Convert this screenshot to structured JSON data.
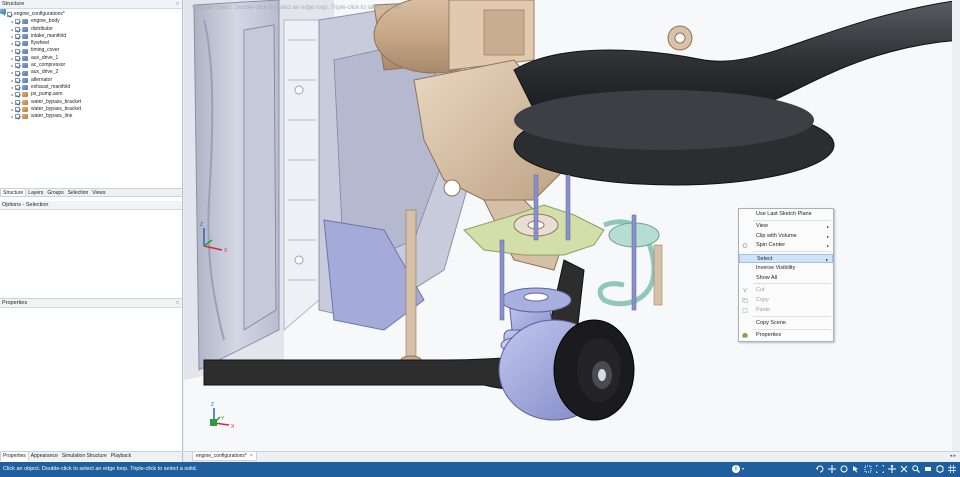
{
  "panels": {
    "structure_title": "Structure",
    "options_title": "Options - Selection",
    "properties_title": "Properties",
    "pin": "□"
  },
  "tree": [
    {
      "label": "engine_configurations*",
      "icon": "root",
      "root": true
    },
    {
      "label": "engine_body",
      "icon": "comp"
    },
    {
      "label": "distributor",
      "icon": "comp"
    },
    {
      "label": "intake_manifold",
      "icon": "comp"
    },
    {
      "label": "flywheel",
      "icon": "comp"
    },
    {
      "label": "timing_cover",
      "icon": "comp"
    },
    {
      "label": "aux_drive_1",
      "icon": "comp"
    },
    {
      "label": "ac_compressor",
      "icon": "comp"
    },
    {
      "label": "aux_drive_2",
      "icon": "comp"
    },
    {
      "label": "alternator",
      "icon": "comp"
    },
    {
      "label": "exhaust_manifold",
      "icon": "comp"
    },
    {
      "label": "ps_pump.asm",
      "icon": "asm"
    },
    {
      "label": "water_bypass_bracket",
      "icon": "asm"
    },
    {
      "label": "water_bypass_bracket",
      "icon": "asm"
    },
    {
      "label": "water_bypass_line",
      "icon": "asm"
    }
  ],
  "panel_tabs": [
    "Structure",
    "Layers",
    "Groups",
    "Selection",
    "Views"
  ],
  "bottom_tabs": [
    "Properties",
    "Appearance",
    "Simulation Structure",
    "Playback"
  ],
  "viewport": {
    "hint": "Click an object. Double-click to select an edge loop. Triple-click to select a solid."
  },
  "document_tab": {
    "label": "engine_configurations*",
    "close": "×",
    "arrows": "◂ ▸"
  },
  "status": {
    "text": "Click an object. Double-click to select an edge loop. Triple-click to select a solid.",
    "info": "i",
    "dropdown": "▾"
  },
  "context_menu": [
    {
      "label": "Use Last Sketch Plane",
      "state": "enabled"
    },
    {
      "label": "View",
      "state": "enabled",
      "submenu": true
    },
    {
      "label": "Clip with Volume",
      "state": "enabled",
      "submenu": true
    },
    {
      "label": "Spin Center",
      "state": "enabled",
      "submenu": true
    },
    {
      "label": "Select",
      "state": "highlighted",
      "submenu": true
    },
    {
      "label": "Inverse Visibility",
      "state": "enabled"
    },
    {
      "label": "Show All",
      "state": "enabled"
    },
    {
      "label": "Cut",
      "state": "disabled"
    },
    {
      "label": "Copy",
      "state": "disabled"
    },
    {
      "label": "Paste",
      "state": "disabled"
    },
    {
      "label": "Copy Scene",
      "state": "enabled"
    },
    {
      "label": "Properties",
      "state": "enabled"
    }
  ],
  "axis": {
    "x": "X",
    "y": "Y",
    "z": "Z"
  },
  "colors": {
    "status_bar": "#1f5f9e",
    "menu_highlight": "#cfe2f7",
    "belt": "#2d2d2d",
    "bracket_tan": "#d9c3a8",
    "engine_body": "#c9ccdb",
    "pulley_blue": "#9aa2d6",
    "green_part": "#c9dba5",
    "teal_line": "#8fc7b9"
  }
}
